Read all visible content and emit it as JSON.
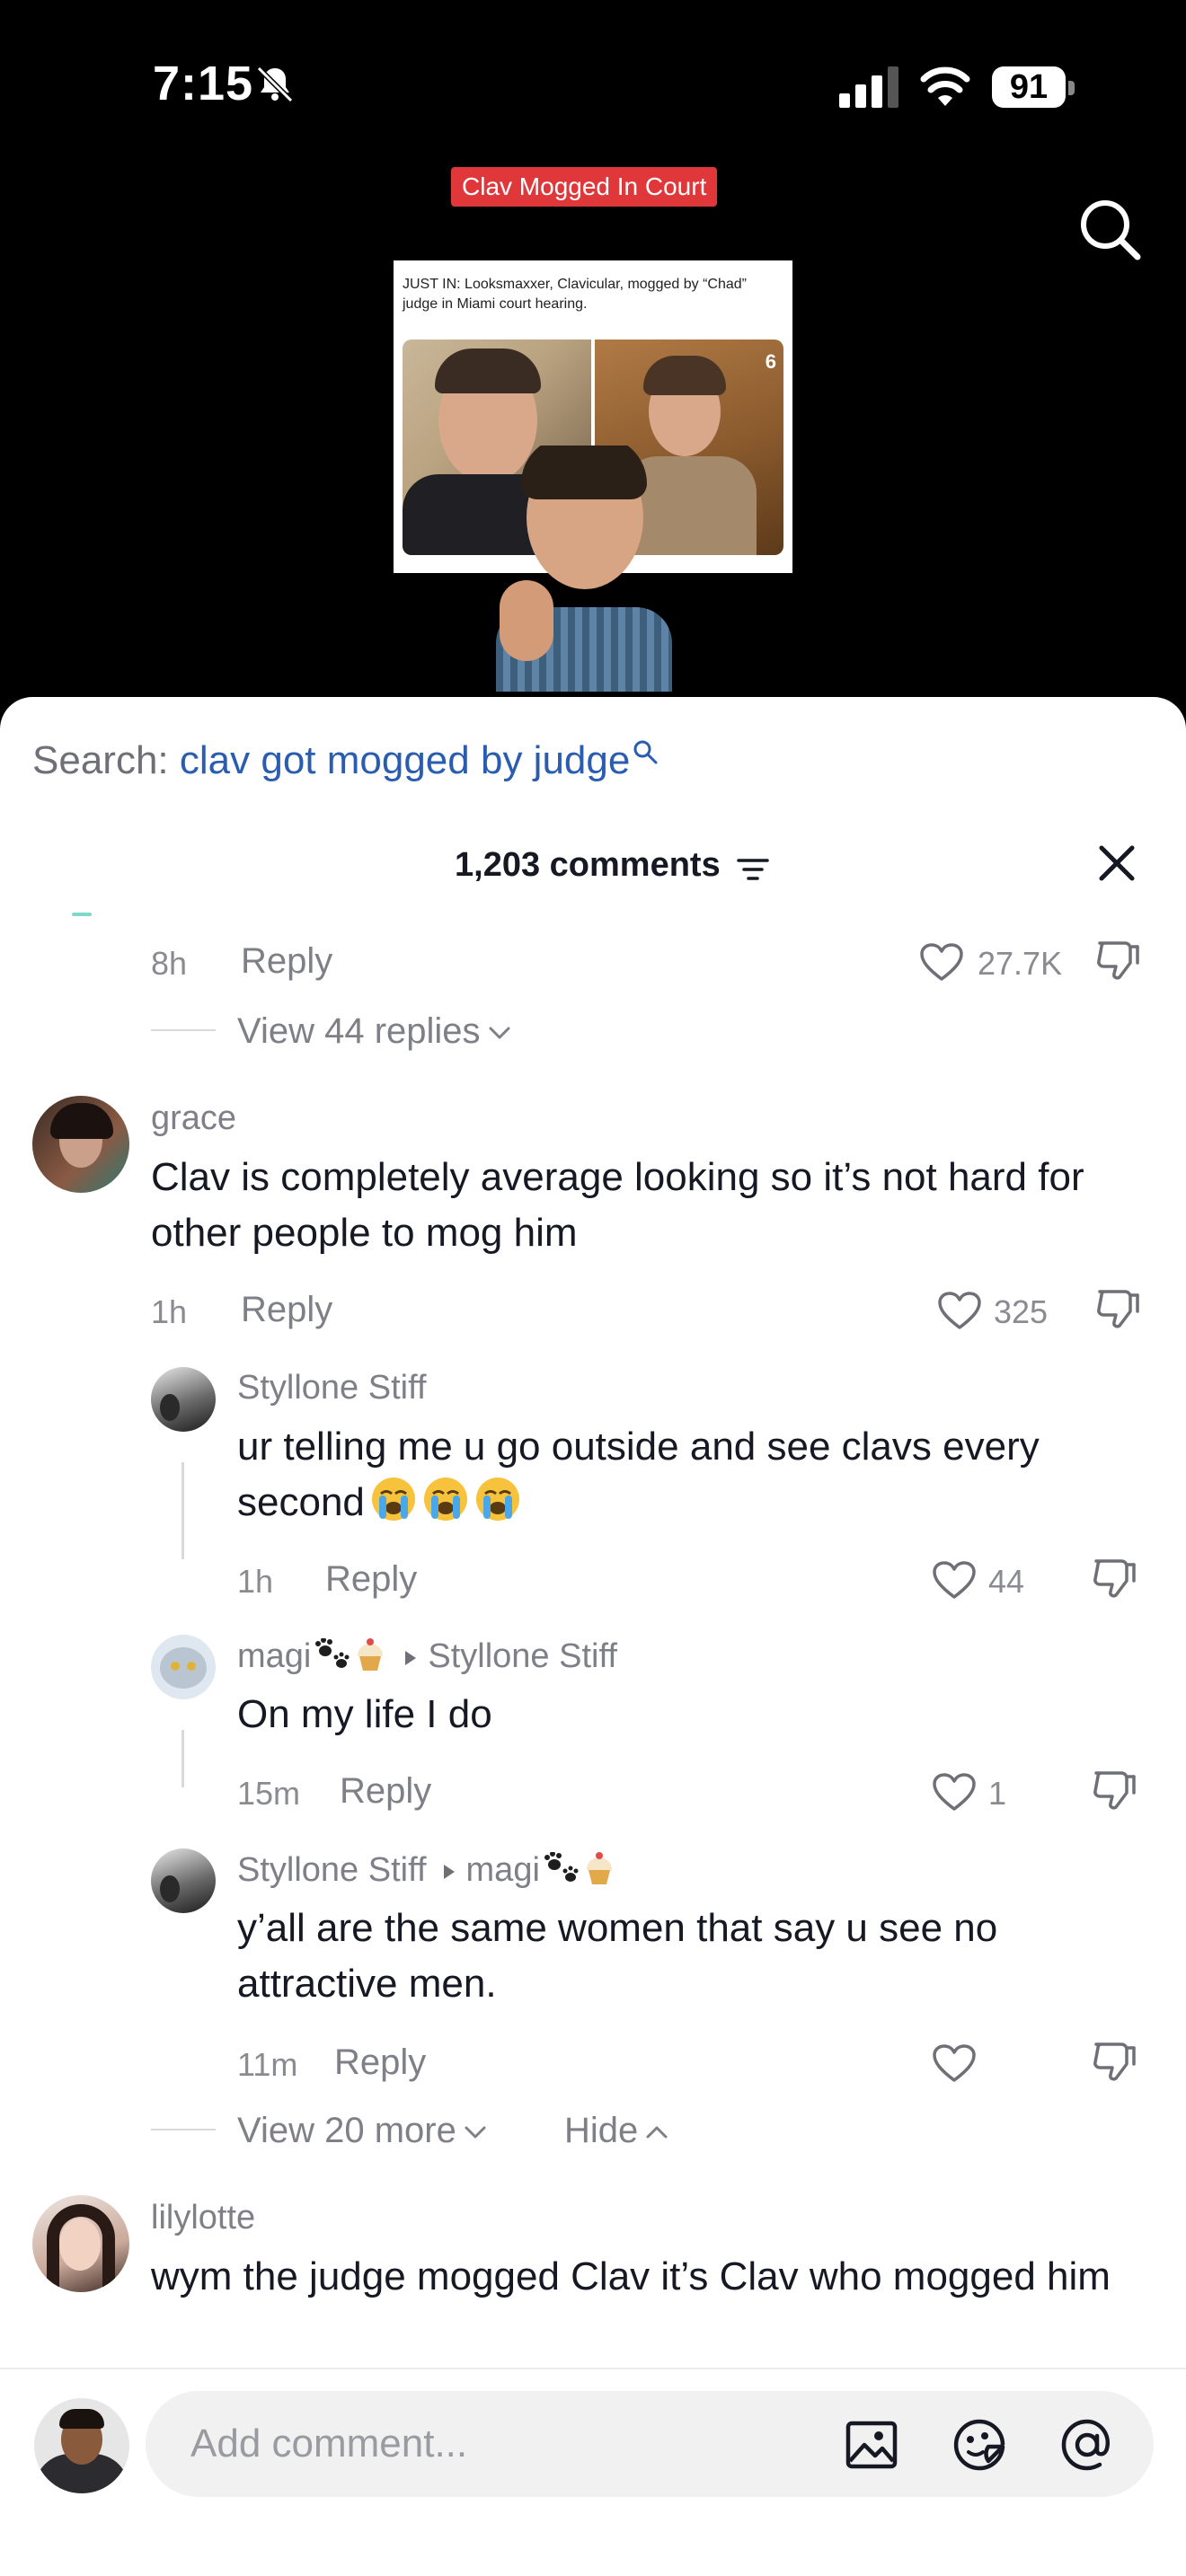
{
  "status_bar": {
    "time": "7:15",
    "battery": "91"
  },
  "video": {
    "tag": "Clav Mogged In Court",
    "news_text": "JUST IN: Looksmaxxer, Clavicular, mogged by “Chad” judge in Miami court hearing.",
    "news_logo": "6"
  },
  "sheet": {
    "search_prefix": "Search:",
    "search_term": "clav got mogged by judge",
    "comment_count": "1,203 comments"
  },
  "first_comment_meta": {
    "time": "8h",
    "reply_label": "Reply",
    "likes": "27.7K",
    "view_replies": "View 44 replies"
  },
  "comments": [
    {
      "user": "grace",
      "text": "Clav is completely average looking so it’s not hard for other people to mog him",
      "time": "1h",
      "reply_label": "Reply",
      "likes": "325"
    },
    {
      "user": "Styllone Stiff",
      "text": "ur telling me u go outside and see clavs every second",
      "emoji": "loudly-crying-face",
      "time": "1h",
      "reply_label": "Reply",
      "likes": "44"
    },
    {
      "user": "magi",
      "user_emoji": "paw-prints, cupcake",
      "reply_to": "Styllone Stiff",
      "text": "On my life I do",
      "time": "15m",
      "reply_label": "Reply",
      "likes": "1"
    },
    {
      "user": "Styllone Stiff",
      "reply_to": "magi",
      "reply_to_emoji": "paw-prints, cupcake",
      "text": "y’all are the same women that say u see no attractive men.",
      "time": "11m",
      "reply_label": "Reply",
      "likes": ""
    },
    {
      "user": "lilylotte",
      "text": "wym the judge mogged Clav it’s Clav who mogged him"
    }
  ],
  "thread_controls": {
    "view_more": "View 20 more",
    "hide": "Hide"
  },
  "composer": {
    "placeholder": "Add comment..."
  },
  "icons": {
    "bell": "bell-slash-icon",
    "signal": "cellular-signal-icon",
    "wifi": "wifi-icon",
    "search": "search-icon",
    "filter": "filter-lines-icon",
    "close": "close-icon",
    "like": "heart-outline-icon",
    "dislike": "thumbs-down-icon",
    "image": "image-icon",
    "sticker": "sticker-icon",
    "mention": "at-sign-icon"
  },
  "colors": {
    "search_term": "#2a5db0",
    "tag_background": "#e0373b"
  }
}
